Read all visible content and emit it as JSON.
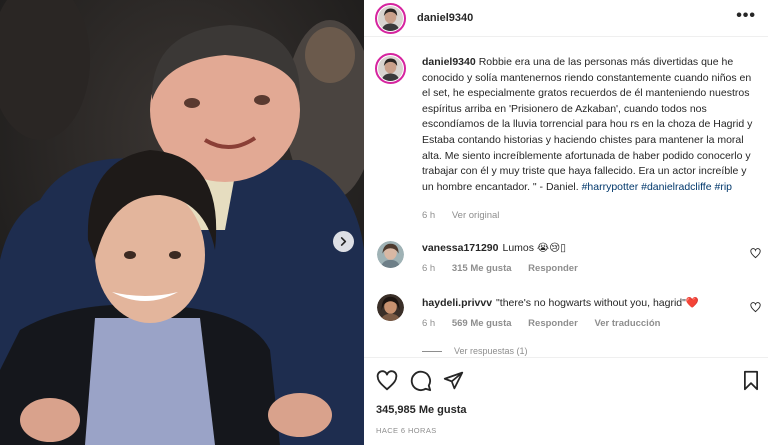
{
  "post": {
    "username": "daniel9340",
    "more_label": "•••",
    "caption": {
      "username": "daniel9340",
      "text": "Robbie era una de las personas más divertidas que he conocido y solía mantenernos riendo constantemente cuando niños en el set, he especialmente gratos recuerdos de él manteniendo nuestros espíritus arriba en 'Prisionero de Azkaban', cuando todos nos escondíamos de la lluvia torrencial para hou rs en la choza de Hagrid y Estaba contando historias y haciendo chistes para mantener la moral alta. Me siento increíblemente afortunada de haber podido conocerlo y trabajar con él y muy triste que haya fallecido. Era un actor increíble y un hombre encantador. \" - Daniel.",
      "hashtags": [
        "#harrypotter",
        "#danielradcliffe",
        "#rip"
      ],
      "time": "6 h",
      "see_original": "Ver original"
    },
    "comments": [
      {
        "username": "vanessa171290",
        "text": "Lumos 😭😢▯",
        "time": "6 h",
        "likes": "315 Me gusta",
        "reply": "Responder",
        "translate": ""
      },
      {
        "username": "haydeli.privvv",
        "text": "\"there's no hogwarts without you, hagrid\"❤️",
        "time": "6 h",
        "likes": "569 Me gusta",
        "reply": "Responder",
        "translate": "Ver traducción"
      }
    ],
    "view_replies": "Ver respuestas (1)",
    "like_count": "345,985 Me gusta",
    "posted_ago": "HACE 6 HORAS"
  },
  "colors": {
    "hashtag": "#00376b",
    "meta_gray": "#8e8e8e",
    "text": "#262626",
    "story_ring": "#d6249f",
    "heart_red": "#ed4956"
  },
  "icons": {
    "carousel_next": "chevron-right-icon",
    "like": "heart-icon",
    "comment": "comment-bubble-icon",
    "share": "paper-plane-icon",
    "save": "bookmark-icon",
    "more": "more-options-icon"
  }
}
